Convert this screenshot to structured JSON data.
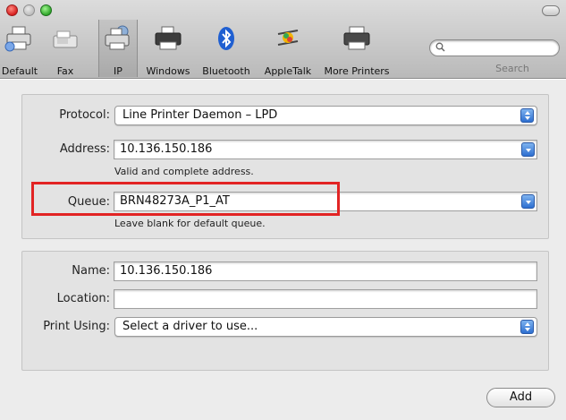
{
  "toolbar": {
    "tools": [
      {
        "label": "Default",
        "icon": "default-printer-icon"
      },
      {
        "label": "Fax",
        "icon": "fax-icon"
      },
      {
        "label": "IP",
        "icon": "ip-printer-icon"
      },
      {
        "label": "Windows",
        "icon": "windows-printer-icon"
      },
      {
        "label": "Bluetooth",
        "icon": "bluetooth-icon"
      },
      {
        "label": "AppleTalk",
        "icon": "appletalk-icon"
      },
      {
        "label": "More Printers",
        "icon": "more-printers-icon"
      }
    ],
    "selected": "IP",
    "search_label": "Search",
    "search_icon": "search-icon"
  },
  "connection": {
    "protocol_label": "Protocol:",
    "protocol_value": "Line Printer Daemon – LPD",
    "address_label": "Address:",
    "address_value": "10.136.150.186",
    "address_hint": "Valid and complete address.",
    "queue_label": "Queue:",
    "queue_value": "BRN48273A_P1_AT",
    "queue_hint": "Leave blank for default queue."
  },
  "printer_info": {
    "name_label": "Name:",
    "name_value": "10.136.150.186",
    "location_label": "Location:",
    "location_value": "",
    "print_using_label": "Print Using:",
    "print_using_value": "Select a driver to use..."
  },
  "actions": {
    "add_label": "Add"
  },
  "colors": {
    "highlight": "#e22424",
    "accent": "#2d6fd0"
  }
}
